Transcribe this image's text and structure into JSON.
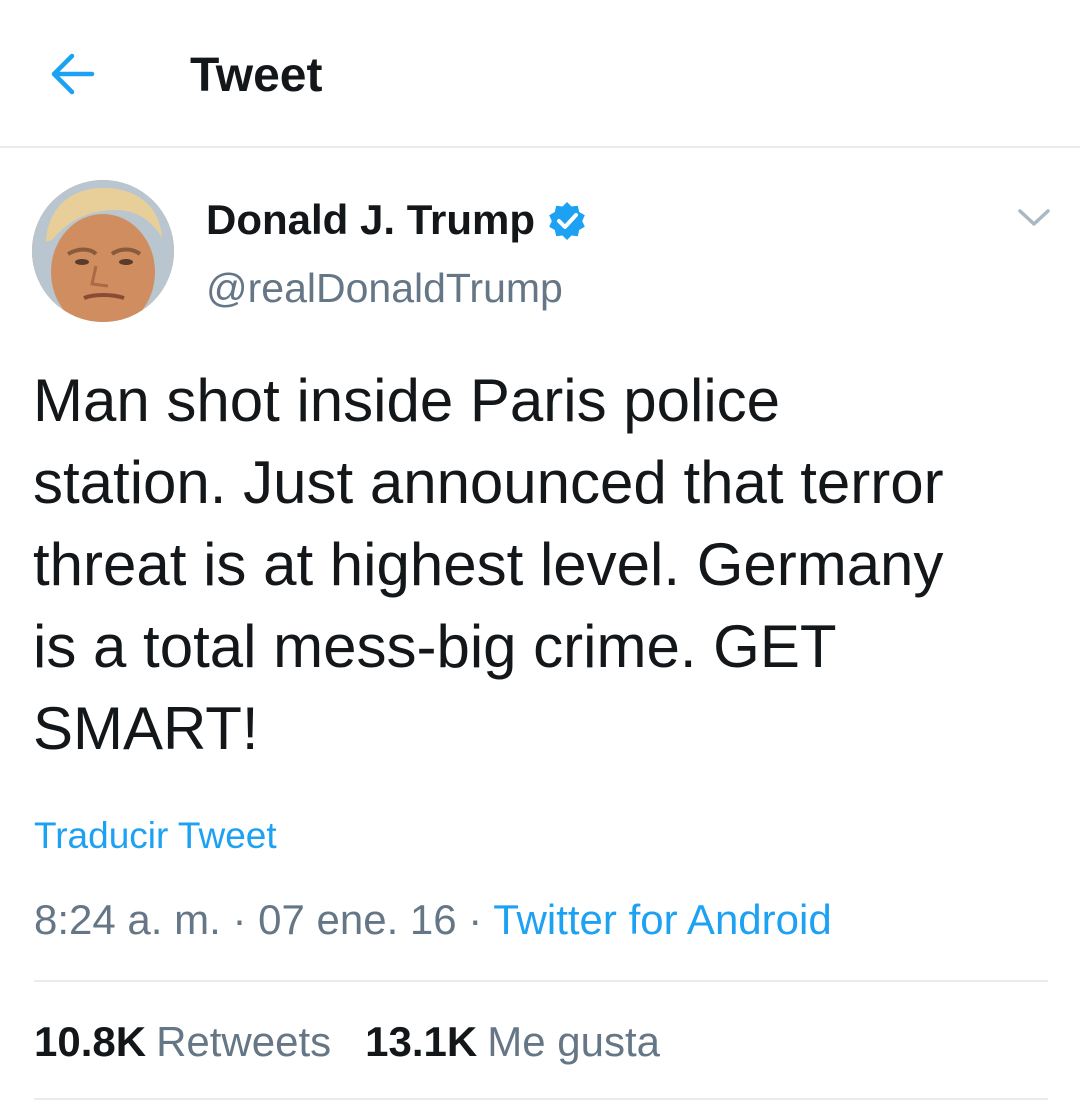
{
  "header": {
    "back_icon": "arrow-left-icon",
    "title": "Tweet",
    "accent_color": "#1da1f2"
  },
  "tweet": {
    "author": {
      "name": "Donald J. Trump",
      "handle": "@realDonaldTrump",
      "verified": true,
      "verified_icon": "verified-badge-icon",
      "avatar_icon": "avatar-photo"
    },
    "menu_icon": "chevron-down-icon",
    "text_lines": [
      "Man shot inside Paris police",
      "station. Just announced that terror",
      "threat is at highest level. Germany",
      "is a total mess-big crime. GET",
      "SMART!"
    ],
    "translate_label": "Traducir Tweet",
    "time": "8:24 a. m.",
    "separator": "·",
    "date": "07 ene. 16",
    "source": "Twitter for Android",
    "stats": {
      "retweets_count": "10.8K",
      "retweets_label": "Retweets",
      "likes_count": "13.1K",
      "likes_label": "Me gusta"
    }
  },
  "colors": {
    "text": "#14171a",
    "secondary": "#657786",
    "link": "#1da1f2",
    "divider": "#e6ecf0"
  }
}
